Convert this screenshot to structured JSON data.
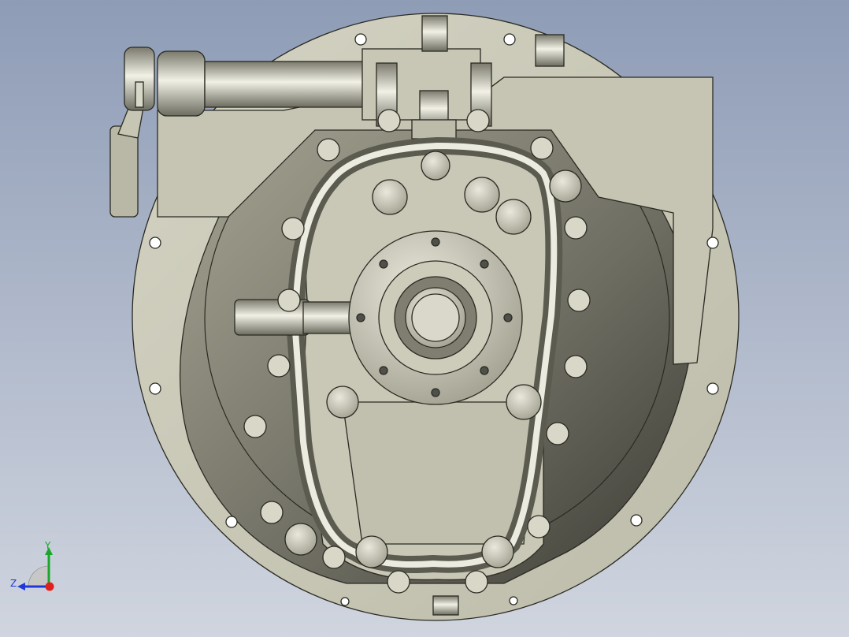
{
  "viewport": {
    "background_top": "#8e9cb6",
    "background_bottom": "#d0d5df",
    "model_fill": "#c9c8b6",
    "model_edge": "#2a2a22",
    "shadow_fill": "#6b6a5e"
  },
  "triad": {
    "y_label": "Y",
    "z_label": "Z",
    "x_color": "#e0201c",
    "y_color": "#1aa62a",
    "z_color": "#2038d8"
  }
}
